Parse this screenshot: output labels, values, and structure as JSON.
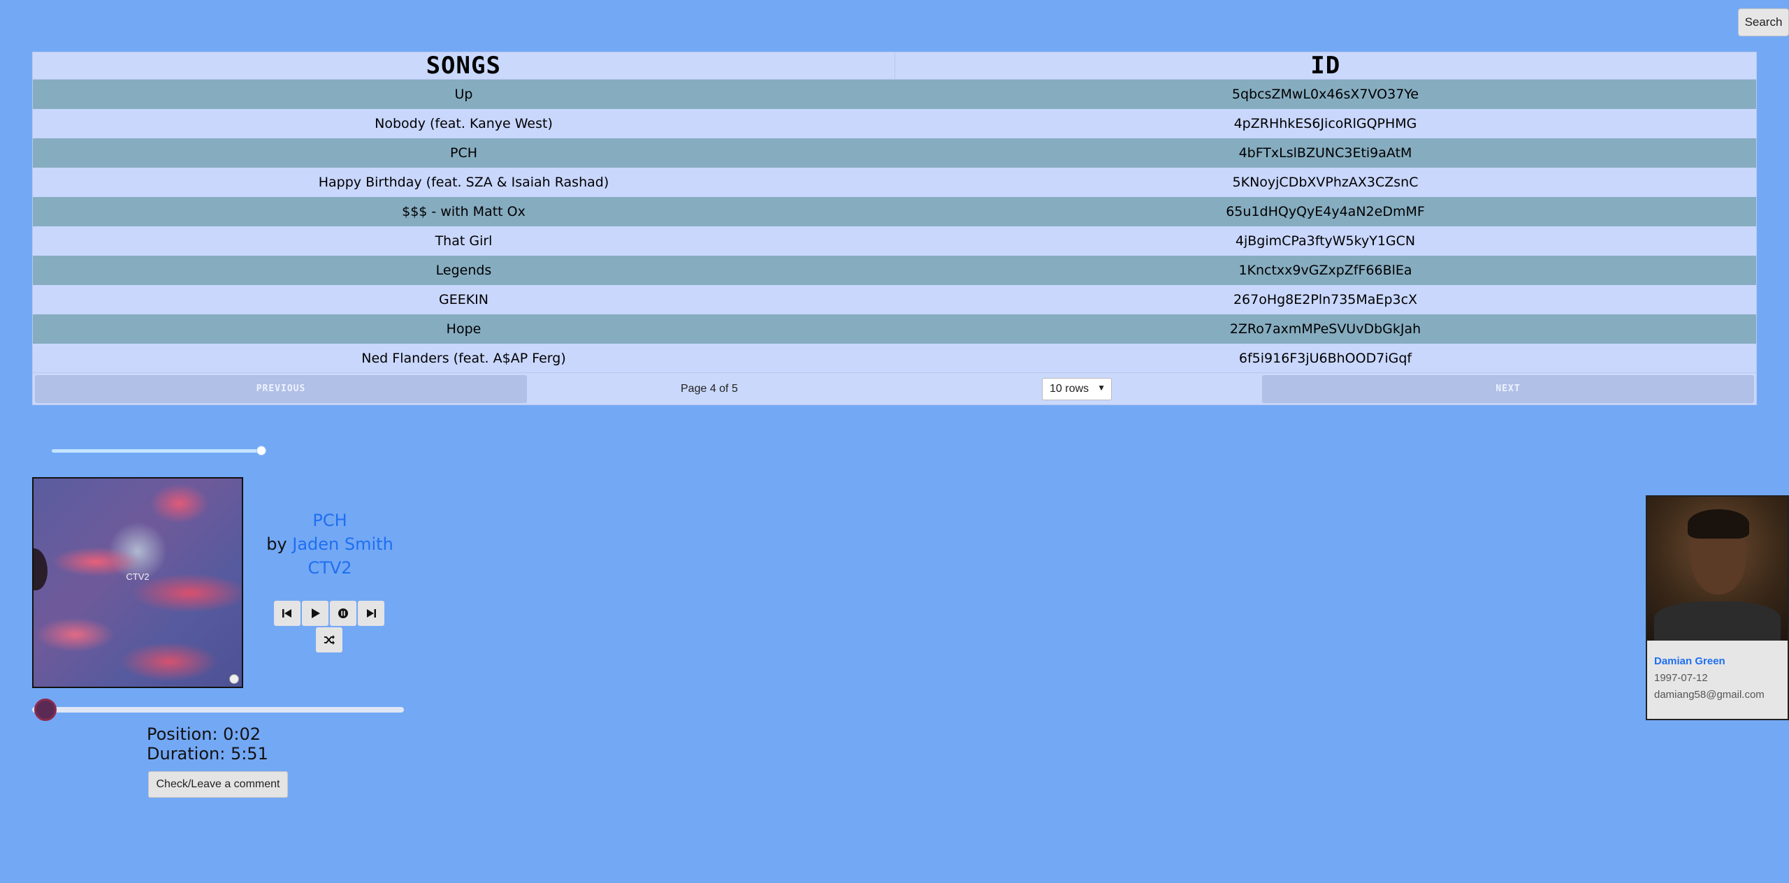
{
  "header": {
    "search_label": "Search"
  },
  "table": {
    "columns": [
      "SONGS",
      "ID"
    ],
    "rows": [
      [
        "Up",
        "5qbcsZMwL0x46sX7VO37Ye"
      ],
      [
        "Nobody (feat. Kanye West)",
        "4pZRHhkES6JicoRlGQPHMG"
      ],
      [
        "PCH",
        "4bFTxLslBZUNC3Eti9aAtM"
      ],
      [
        "Happy Birthday (feat. SZA & Isaiah Rashad)",
        "5KNoyjCDbXVPhzAX3CZsnC"
      ],
      [
        "$$$ - with Matt Ox",
        "65u1dHQyQyE4y4aN2eDmMF"
      ],
      [
        "That Girl",
        "4jBgimCPa3ftyW5kyY1GCN"
      ],
      [
        "Legends",
        "1Knctxx9vGZxpZfF66BlEa"
      ],
      [
        "GEEKIN",
        "267oHg8E2Pln735MaEp3cX"
      ],
      [
        "Hope",
        "2ZRo7axmMPeSVUvDbGkJah"
      ],
      [
        "Ned Flanders (feat. A$AP Ferg)",
        "6f5i916F3jU6BhOOD7iGqf"
      ]
    ],
    "pagination": {
      "previous_label": "PREVIOUS",
      "next_label": "NEXT",
      "page_info": "Page 4 of 5",
      "rows_selected": "10 rows"
    }
  },
  "player": {
    "volume": 1.0,
    "album_label": "CTV2",
    "track_title": "PCH",
    "by_label": "by",
    "artist": "Jaden Smith",
    "album": "CTV2",
    "position_text": "Position: 0:02",
    "duration_text": "Duration: 5:51",
    "progress": 0.006,
    "comment_label": "Check/Leave a comment"
  },
  "profile": {
    "name": "Damian Green",
    "birthdate": "1997-07-12",
    "email": "damiang58@gmail.com"
  }
}
